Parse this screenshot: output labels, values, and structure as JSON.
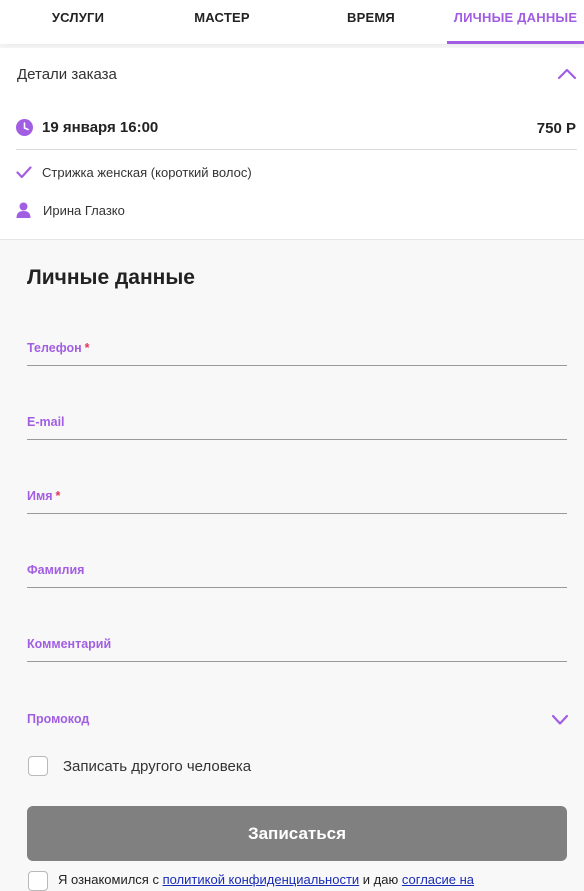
{
  "tabs": [
    {
      "label": "УСЛУГИ"
    },
    {
      "label": "МАСТЕР"
    },
    {
      "label": "ВРЕМЯ"
    },
    {
      "label": "ЛИЧНЫЕ ДАННЫЕ",
      "active": true
    }
  ],
  "order_details": {
    "title": "Детали заказа",
    "datetime": "19 января 16:00",
    "price": "750 Р",
    "service": "Стрижка женская (короткий волос)",
    "master": "Ирина Глазко"
  },
  "form": {
    "title": "Личные данные",
    "fields": [
      {
        "label": "Телефон",
        "required": "*"
      },
      {
        "label": "E-mail"
      },
      {
        "label": "Имя",
        "required": "*"
      },
      {
        "label": "Фамилия"
      },
      {
        "label": "Комментарий"
      }
    ],
    "promo_label": "Промокод",
    "other_person_label": "Записать другого человека",
    "submit_label": "Записаться",
    "consent": {
      "prefix": "Я ознакомился с ",
      "link1": "политикой конфиденциальности",
      "middle": " и даю ",
      "link2": "согласие на"
    }
  },
  "colors": {
    "accent": "#a25ee3",
    "required": "#e0355c",
    "button": "#808080"
  },
  "icons": [
    "clock-icon",
    "check-icon",
    "person-icon",
    "chevron-up-icon",
    "chevron-down-icon"
  ]
}
